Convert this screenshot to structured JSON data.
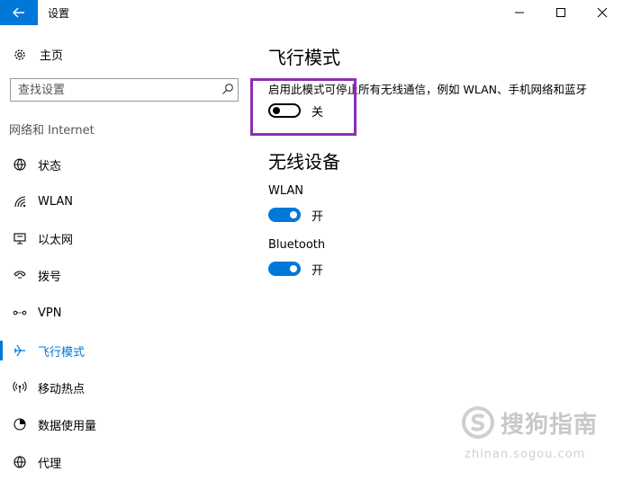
{
  "window": {
    "title": "设置",
    "back_icon": "back-arrow-icon",
    "minimize_icon": "minimize-icon",
    "maximize_icon": "maximize-icon",
    "close_icon": "close-icon"
  },
  "sidebar": {
    "home_label": "主页",
    "home_icon": "gear-icon",
    "search_placeholder": "查找设置",
    "search_icon": "search-icon",
    "section_header": "网络和 Internet",
    "items": [
      {
        "label": "状态",
        "icon": "globe-icon",
        "active": false
      },
      {
        "label": "WLAN",
        "icon": "wifi-icon",
        "active": false
      },
      {
        "label": "以太网",
        "icon": "ethernet-icon",
        "active": false
      },
      {
        "label": "拨号",
        "icon": "phone-icon",
        "active": false
      },
      {
        "label": "VPN",
        "icon": "vpn-icon",
        "active": false
      },
      {
        "label": "飞行模式",
        "icon": "airplane-icon",
        "active": true
      },
      {
        "label": "移动热点",
        "icon": "hotspot-icon",
        "active": false
      },
      {
        "label": "数据使用量",
        "icon": "data-usage-icon",
        "active": false
      },
      {
        "label": "代理",
        "icon": "globe-icon",
        "active": false
      }
    ]
  },
  "main": {
    "title": "飞行模式",
    "description": "启用此模式可停止所有无线通信，例如 WLAN、手机网络和蓝牙",
    "airplane_toggle": {
      "state": "off",
      "state_label": "关"
    },
    "wireless_title": "无线设备",
    "wlan": {
      "label": "WLAN",
      "state": "on",
      "state_label": "开"
    },
    "bluetooth": {
      "label": "Bluetooth",
      "state": "on",
      "state_label": "开"
    }
  },
  "watermark": {
    "text": "搜狗指南",
    "subtext": "zhinan.sogou.com"
  },
  "colors": {
    "accent": "#0078d7",
    "highlight": "#8c2fb5"
  }
}
